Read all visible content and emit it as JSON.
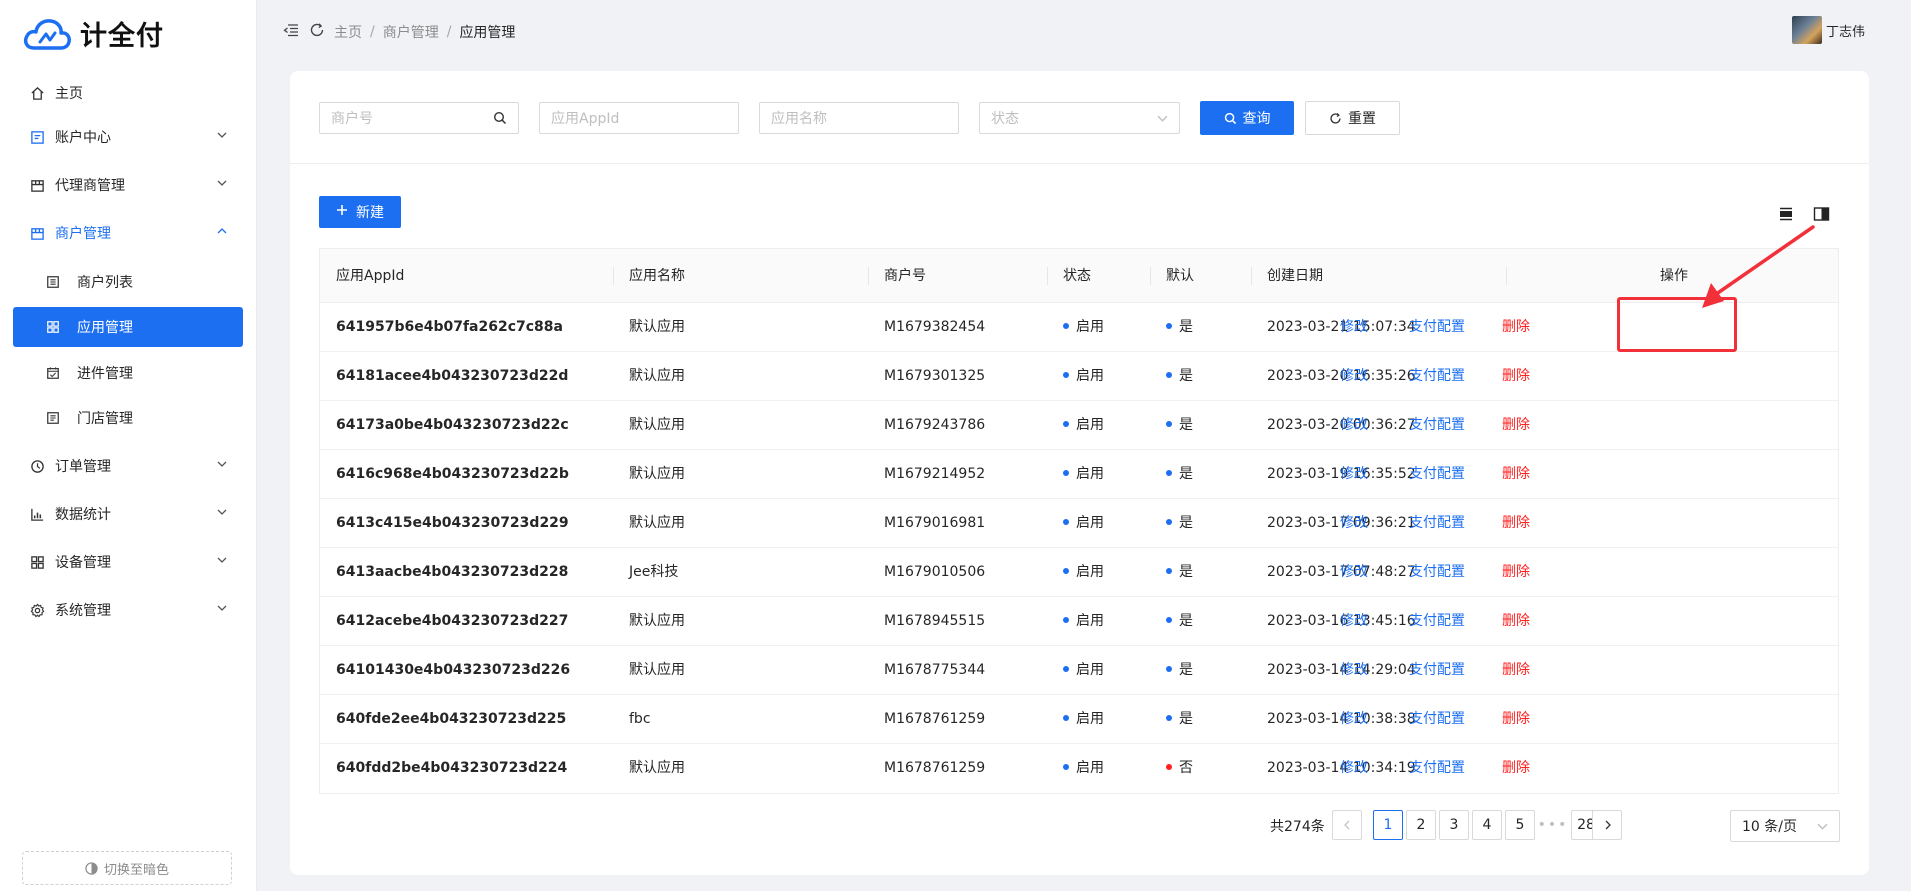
{
  "app": {
    "name": "计全付"
  },
  "colors": {
    "primary": "#1d6ff2",
    "danger": "#ff1f1f",
    "annotation": "#f2303a"
  },
  "sidebar": {
    "items": [
      {
        "label": "主页",
        "icon": "home-icon"
      },
      {
        "label": "账户中心",
        "icon": "account-icon"
      },
      {
        "label": "代理商管理",
        "icon": "agent-icon"
      },
      {
        "label": "商户管理",
        "icon": "merchant-icon"
      },
      {
        "label": "商户列表",
        "icon": "list-icon"
      },
      {
        "label": "应用管理",
        "icon": "grid-icon"
      },
      {
        "label": "进件管理",
        "icon": "onboarding-icon"
      },
      {
        "label": "门店管理",
        "icon": "store-icon"
      },
      {
        "label": "订单管理",
        "icon": "order-icon"
      },
      {
        "label": "数据统计",
        "icon": "chart-icon"
      },
      {
        "label": "设备管理",
        "icon": "device-icon"
      },
      {
        "label": "系统管理",
        "icon": "gear-icon"
      }
    ],
    "theme_toggle": "切换至暗色"
  },
  "header": {
    "breadcrumb": [
      "主页",
      "商户管理",
      "应用管理"
    ],
    "username": "丁志伟"
  },
  "filters": {
    "merchant_no_placeholder": "商户号",
    "appid_placeholder": "应用AppId",
    "app_name_placeholder": "应用名称",
    "status_placeholder": "状态",
    "query_label": "查询",
    "reset_label": "重置"
  },
  "toolbar": {
    "new_label": "新建"
  },
  "table": {
    "columns": [
      "应用AppId",
      "应用名称",
      "商户号",
      "状态",
      "默认",
      "创建日期",
      "操作"
    ],
    "action_labels": {
      "edit": "修改",
      "pay_config": "支付配置",
      "delete": "删除"
    },
    "rows": [
      {
        "appid": "641957b6e4b07fa262c7c88a",
        "name": "默认应用",
        "merchant": "M1679382454",
        "status": "启用",
        "default": "是",
        "default_color": "#1d6ff2",
        "created": "2023-03-21 15:07:34"
      },
      {
        "appid": "64181acee4b043230723d22d",
        "name": "默认应用",
        "merchant": "M1679301325",
        "status": "启用",
        "default": "是",
        "default_color": "#1d6ff2",
        "created": "2023-03-20 16:35:26"
      },
      {
        "appid": "64173a0be4b043230723d22c",
        "name": "默认应用",
        "merchant": "M1679243786",
        "status": "启用",
        "default": "是",
        "default_color": "#1d6ff2",
        "created": "2023-03-20 00:36:27"
      },
      {
        "appid": "6416c968e4b043230723d22b",
        "name": "默认应用",
        "merchant": "M1679214952",
        "status": "启用",
        "default": "是",
        "default_color": "#1d6ff2",
        "created": "2023-03-19 16:35:52"
      },
      {
        "appid": "6413c415e4b043230723d229",
        "name": "默认应用",
        "merchant": "M1679016981",
        "status": "启用",
        "default": "是",
        "default_color": "#1d6ff2",
        "created": "2023-03-17 09:36:21"
      },
      {
        "appid": "6413aacbe4b043230723d228",
        "name": "Jee科技",
        "merchant": "M1679010506",
        "status": "启用",
        "default": "是",
        "default_color": "#1d6ff2",
        "created": "2023-03-17 07:48:27"
      },
      {
        "appid": "6412acebe4b043230723d227",
        "name": "默认应用",
        "merchant": "M1678945515",
        "status": "启用",
        "default": "是",
        "default_color": "#1d6ff2",
        "created": "2023-03-16 13:45:16"
      },
      {
        "appid": "64101430e4b043230723d226",
        "name": "默认应用",
        "merchant": "M1678775344",
        "status": "启用",
        "default": "是",
        "default_color": "#1d6ff2",
        "created": "2023-03-14 14:29:04"
      },
      {
        "appid": "640fde2ee4b043230723d225",
        "name": "fbc",
        "merchant": "M1678761259",
        "status": "启用",
        "default": "是",
        "default_color": "#1d6ff2",
        "created": "2023-03-14 10:38:38"
      },
      {
        "appid": "640fdd2be4b043230723d224",
        "name": "默认应用",
        "merchant": "M1678761259",
        "status": "启用",
        "default": "否",
        "default_color": "#ff1f1f",
        "created": "2023-03-14 10:34:19"
      }
    ]
  },
  "pagination": {
    "total_text": "共274条",
    "pages": [
      "1",
      "2",
      "3",
      "4",
      "5",
      "•••",
      "28"
    ],
    "current": "1",
    "page_size": "10 条/页"
  }
}
